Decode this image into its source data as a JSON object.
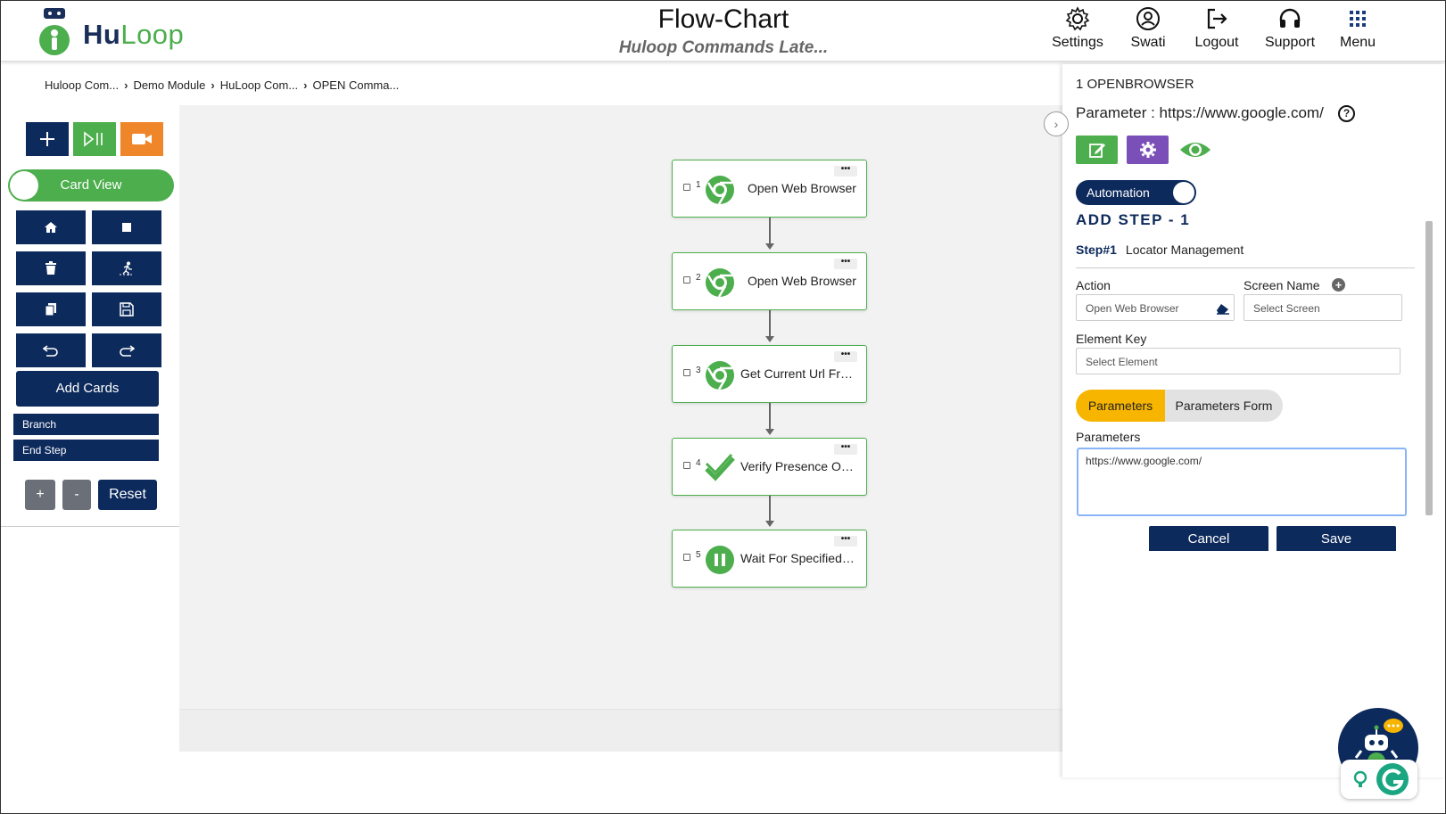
{
  "header": {
    "logo_hu": "Hu",
    "logo_loop": "Loop",
    "title": "Flow-Chart",
    "subtitle": "Huloop Commands Late...",
    "nav": [
      {
        "label": "Settings",
        "icon": "gear-icon"
      },
      {
        "label": "Swati",
        "icon": "user-icon"
      },
      {
        "label": "Logout",
        "icon": "logout-icon"
      },
      {
        "label": "Support",
        "icon": "headset-icon"
      },
      {
        "label": "Menu",
        "icon": "grid-icon"
      }
    ]
  },
  "breadcrumb": [
    "Huloop Com...",
    "Demo Module",
    "HuLoop Com...",
    "OPEN Comma..."
  ],
  "leftpanel": {
    "card_view": "Card View",
    "add_cards": "Add Cards",
    "branch": "Branch",
    "end_step": "End Step",
    "zoom_in": "+",
    "zoom_out": "-",
    "reset": "Reset"
  },
  "cards": [
    {
      "num": "1",
      "label": "Open Web Browser",
      "icon": "chrome-icon"
    },
    {
      "num": "2",
      "label": "Open Web Browser",
      "icon": "chrome-icon"
    },
    {
      "num": "3",
      "label": "Get Current Url Fro...",
      "icon": "chrome-icon"
    },
    {
      "num": "4",
      "label": "Verify Presence Of ...",
      "icon": "check-icon"
    },
    {
      "num": "5",
      "label": "Wait For Specified ...",
      "icon": "pause-icon"
    }
  ],
  "card_menu": "•••",
  "rightpanel": {
    "step_title": "1 OPENBROWSER",
    "parameter_line": "Parameter : https://www.google.com/",
    "help": "?",
    "automation": "Automation",
    "add_step": "ADD STEP - 1",
    "step_id": "Step#1",
    "step_section": "Locator Management",
    "action_label": "Action",
    "action_value": "Open Web Browser",
    "screen_label": "Screen Name",
    "screen_placeholder": "Select Screen",
    "element_label": "Element Key",
    "element_placeholder": "Select Element",
    "tab_parameters": "Parameters",
    "tab_parameters_form": "Parameters Form",
    "parameters_label": "Parameters",
    "parameters_value": "https://www.google.com/",
    "cancel": "Cancel",
    "save": "Save"
  },
  "colors": {
    "navy": "#0d2a5c",
    "green": "#4cae4c",
    "orange": "#f0862a",
    "purple": "#7b4fb8",
    "yellow": "#f7b500"
  }
}
